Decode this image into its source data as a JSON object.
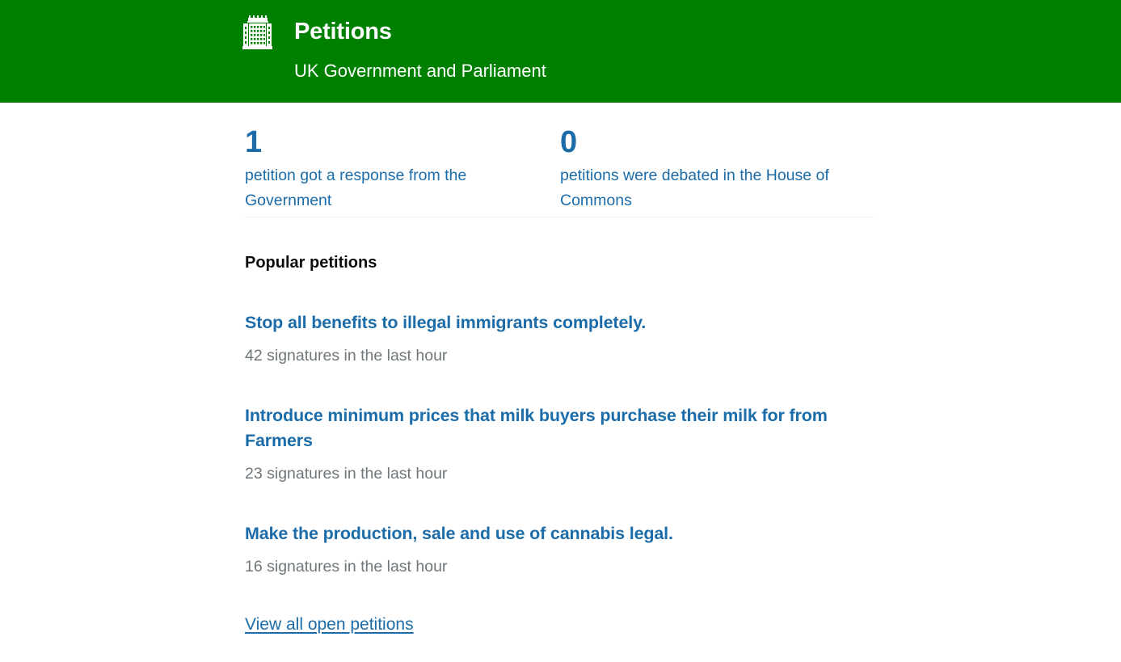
{
  "theme": {
    "header_green": "#008000",
    "link_blue": "#1b6ca8",
    "meta_grey": "#6f777b",
    "heading_black": "#0b0c0c",
    "divider_grey": "#f2f3f4"
  },
  "header": {
    "crest_icon": "portcullis-icon",
    "title": "Petitions",
    "subtitle": "UK Government and Parliament"
  },
  "stats": [
    {
      "number": "1",
      "label": "petition got a response from the Government"
    },
    {
      "number": "0",
      "label": "petitions were debated in the House of Commons"
    }
  ],
  "popular": {
    "heading": "Popular petitions",
    "petitions": [
      {
        "title": "Stop all benefits to illegal immigrants completely.",
        "count": "42",
        "meta_suffix": "signatures in the last hour"
      },
      {
        "title": "Introduce minimum prices that milk buyers purchase their milk for from Farmers",
        "count": "23",
        "meta_suffix": "signatures in the last hour"
      },
      {
        "title": "Make the production, sale and use of cannabis legal.",
        "count": "16",
        "meta_suffix": "signatures in the last hour"
      }
    ],
    "view_all_label": "View all open petitions"
  }
}
